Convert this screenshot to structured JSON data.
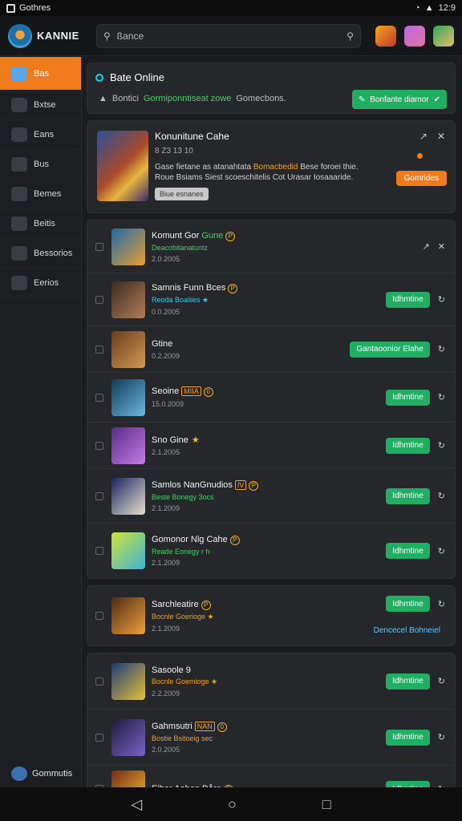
{
  "status": {
    "app": "Gothres",
    "time": "12:9"
  },
  "header": {
    "logo": "KANNIE",
    "search_value": "ßance"
  },
  "sidebar": {
    "items": [
      {
        "label": "Bas",
        "active": true,
        "icon": "cloud-icon"
      },
      {
        "label": "Bxtse",
        "icon": "phone-icon"
      },
      {
        "label": "Eans",
        "icon": "avatar-icon"
      },
      {
        "label": "Bus",
        "icon": "box-icon"
      },
      {
        "label": "Bemes",
        "icon": "house-icon"
      },
      {
        "label": "Beitis",
        "icon": "panel-icon"
      },
      {
        "label": "Bessorios",
        "icon": "avatar-pink-icon"
      },
      {
        "label": "Eerios",
        "icon": "image-icon"
      }
    ],
    "bottom": "Gommutis"
  },
  "online": {
    "title": "Bate Online",
    "sub_a": "Bontici",
    "sub_hl": "Gormiponntiseat zowe",
    "sub_b": "Gomecbons.",
    "button": "Bonfante diamor"
  },
  "featured": {
    "title": "Konunitune Cahe",
    "meta": "8 Z3 13 10",
    "desc_a": "Gase fietane as atanahtata",
    "desc_hl": "Bomacbedid",
    "desc_b": "Bese foroei thie. Roue Bsiams Siest scoeschitelis Cot Urasar Iosaaaride.",
    "tag": "Biue esnanes",
    "button": "Gomrides"
  },
  "colors": {
    "accent": "#f07b1a",
    "green": "#1fae62",
    "cyan": "#35c7e6"
  },
  "groups": [
    {
      "rows": [
        {
          "title": "Komunt Gor",
          "hl": "Gune",
          "badge": "P",
          "sub": "Deacobitanatuntz",
          "sub_color": "#46d06c",
          "date": "2.0.2005",
          "thumb": [
            "#1e6aa8",
            "#e79f34"
          ],
          "action": "",
          "icons": [
            "↗",
            "✕"
          ]
        },
        {
          "title": "Samnis Funn Bces",
          "badge": "P",
          "sub": "Reoda Boaliies ★",
          "sub_color": "#45c6e6",
          "date": "0.0.2005",
          "thumb": [
            "#3a2a22",
            "#b27d58"
          ],
          "action": "Idhmtine",
          "icons": [
            "↻"
          ]
        },
        {
          "title": "Gtine",
          "sub": "",
          "date": "0.2.2009",
          "thumb": [
            "#6a3a1c",
            "#d29b52"
          ],
          "action": "Gantaoonior Elahe",
          "icons": [
            "↻"
          ]
        },
        {
          "title": "Seoine",
          "lvl": "MIIA",
          "badge": "0",
          "sub": "",
          "date": "15.0.2009",
          "thumb": [
            "#0f3a57",
            "#6db7e0"
          ],
          "action": "Idhmtine",
          "icons": [
            "↻"
          ]
        },
        {
          "title": "Sno Gine",
          "star": true,
          "sub": "",
          "date": "2.1.2005",
          "thumb": [
            "#5a2a86",
            "#c37ee6"
          ],
          "action": "Idhmtine",
          "icons": [
            "↻"
          ]
        },
        {
          "title": "Samlos NanGnudios",
          "lvl": "IV",
          "badge": "P",
          "sub": "Beste Bonegy 3ocs",
          "sub_color": "#46d06c",
          "date": "2.1.2009",
          "thumb": [
            "#1c2460",
            "#e8e0d0"
          ],
          "action": "Idhmtine",
          "icons": [
            "↻"
          ]
        },
        {
          "title": "Gomonor Nlg Cahe",
          "badge": "P",
          "sub": "Reade Eonegy r h",
          "sub_color": "#46d06c",
          "date": "2.1.2009",
          "thumb": [
            "#cde43a",
            "#3ab2d8"
          ],
          "action": "Idhmtine",
          "icons": [
            "↻"
          ]
        }
      ]
    },
    {
      "rows": [
        {
          "title": "Sarchleatire",
          "badge": "P",
          "sub": "Bocnle Goerioge ★",
          "sub_color": "#f0a020",
          "date": "2.1.2009",
          "thumb": [
            "#4e2a12",
            "#f0a13c"
          ],
          "action": "Idhmtine",
          "icons": [
            "↻"
          ],
          "note": "Dencecel Bohneiel"
        }
      ]
    },
    {
      "rows": [
        {
          "title": "Sasoole 9",
          "sub": "Bocnle Goemioge ★",
          "sub_color": "#f0a020",
          "date": "2.2.2009",
          "thumb": [
            "#1c3c78",
            "#e6c13a"
          ],
          "action": "Idhmtine",
          "icons": [
            "↻"
          ]
        },
        {
          "title": "Gahmsutri",
          "lvl": "NAN",
          "badge": "0",
          "sub": "Bostie Bsitoeig sec",
          "sub_color": "#f0a020",
          "date": "2.0.2005",
          "thumb": [
            "#1e1a3c",
            "#7a63c8"
          ],
          "action": "Idhmtine",
          "icons": [
            "↻"
          ]
        },
        {
          "title": "Eiher Aohen Dåre",
          "badge": "P",
          "sub": "",
          "date": "",
          "thumb": [
            "#7a2a12",
            "#f2c23a"
          ],
          "action": "Idhmtine",
          "icons": [
            "↻"
          ]
        }
      ]
    }
  ],
  "nav": {
    "back": "◁",
    "home": "○",
    "recents": "□"
  }
}
